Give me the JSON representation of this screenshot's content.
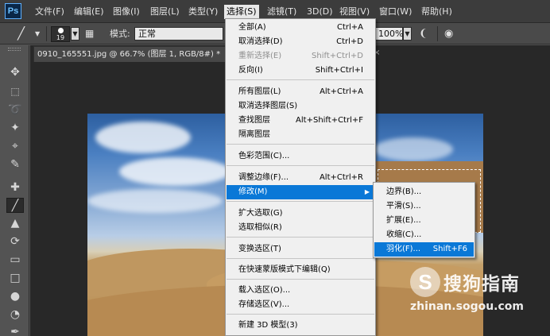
{
  "app": {
    "logo": "Ps"
  },
  "menubar": {
    "items": [
      {
        "label": "文件(F)"
      },
      {
        "label": "编辑(E)"
      },
      {
        "label": "图像(I)"
      },
      {
        "label": "图层(L)"
      },
      {
        "label": "类型(Y)"
      },
      {
        "label": "选择(S)"
      },
      {
        "label": "滤镜(T)"
      },
      {
        "label": "3D(D)"
      },
      {
        "label": "视图(V)"
      },
      {
        "label": "窗口(W)"
      },
      {
        "label": "帮助(H)"
      }
    ],
    "active_index": 5
  },
  "options_bar": {
    "brush_size": "19",
    "mode_label": "模式:",
    "mode_value": "正常",
    "opacity_value": "100%"
  },
  "document": {
    "tab_title": "0910_165551.jpg @ 66.7% (图层 1, RGB/8#) *",
    "close_glyph": "×"
  },
  "select_menu": {
    "items": [
      {
        "label": "全部(A)",
        "shortcut": "Ctrl+A",
        "disabled": false
      },
      {
        "label": "取消选择(D)",
        "shortcut": "Ctrl+D",
        "disabled": false
      },
      {
        "label": "重新选择(E)",
        "shortcut": "Shift+Ctrl+D",
        "disabled": true
      },
      {
        "label": "反向(I)",
        "shortcut": "Shift+Ctrl+I",
        "disabled": false
      },
      {
        "label": "所有图层(L)",
        "shortcut": "Alt+Ctrl+A",
        "disabled": false
      },
      {
        "label": "取消选择图层(S)",
        "shortcut": "",
        "disabled": false
      },
      {
        "label": "查找图层",
        "shortcut": "Alt+Shift+Ctrl+F",
        "disabled": false
      },
      {
        "label": "隔离图层",
        "shortcut": "",
        "disabled": false
      },
      {
        "label": "色彩范围(C)...",
        "shortcut": "",
        "disabled": false
      },
      {
        "label": "调整边缘(F)...",
        "shortcut": "Alt+Ctrl+R",
        "disabled": false
      },
      {
        "label": "修改(M)",
        "shortcut": "",
        "disabled": false,
        "submenu": true,
        "highlighted": true
      },
      {
        "label": "扩大选取(G)",
        "shortcut": "",
        "disabled": false
      },
      {
        "label": "选取相似(R)",
        "shortcut": "",
        "disabled": false
      },
      {
        "label": "变换选区(T)",
        "shortcut": "",
        "disabled": false
      },
      {
        "label": "在快速蒙版模式下编辑(Q)",
        "shortcut": "",
        "disabled": false
      },
      {
        "label": "载入选区(O)...",
        "shortcut": "",
        "disabled": false
      },
      {
        "label": "存储选区(V)...",
        "shortcut": "",
        "disabled": false
      },
      {
        "label": "新建 3D 模型(3)",
        "shortcut": "",
        "disabled": false
      }
    ]
  },
  "modify_submenu": {
    "items": [
      {
        "label": "边界(B)...",
        "shortcut": ""
      },
      {
        "label": "平滑(S)...",
        "shortcut": ""
      },
      {
        "label": "扩展(E)...",
        "shortcut": ""
      },
      {
        "label": "收缩(C)...",
        "shortcut": ""
      },
      {
        "label": "羽化(F)...",
        "shortcut": "Shift+F6",
        "highlighted": true
      }
    ]
  },
  "watermark": {
    "logo_letter": "S",
    "brand": "搜狗指南",
    "url": "zhinan.sogou.com"
  },
  "tools": [
    {
      "icon": "move-tool-icon"
    },
    {
      "icon": "marquee-tool-icon"
    },
    {
      "icon": "lasso-tool-icon"
    },
    {
      "icon": "quick-select-tool-icon"
    },
    {
      "icon": "crop-tool-icon"
    },
    {
      "icon": "eyedropper-tool-icon"
    },
    {
      "icon": "healing-tool-icon"
    },
    {
      "icon": "brush-tool-icon"
    },
    {
      "icon": "stamp-tool-icon"
    },
    {
      "icon": "history-brush-tool-icon"
    },
    {
      "icon": "eraser-tool-icon"
    },
    {
      "icon": "gradient-tool-icon"
    },
    {
      "icon": "blur-tool-icon"
    },
    {
      "icon": "dodge-tool-icon"
    },
    {
      "icon": "pen-tool-icon"
    }
  ],
  "colors": {
    "menu_highlight": "#0a78d7",
    "menubar_bg": "#3c3c3c",
    "workspace_bg": "#282828"
  }
}
